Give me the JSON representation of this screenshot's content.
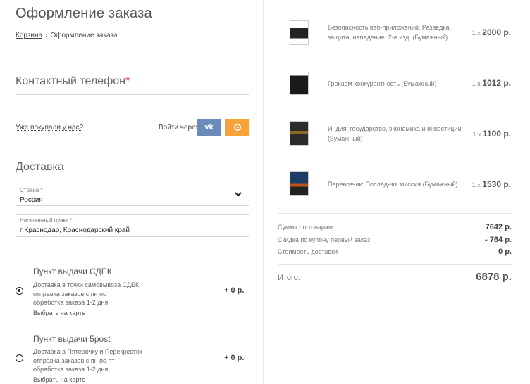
{
  "header": {
    "title": "Оформление заказа",
    "breadcrumb": {
      "cart": "Корзина",
      "separator": "›",
      "current": "Оформление заказа"
    }
  },
  "contact": {
    "title": "Контактный телефон",
    "required_mark": "*",
    "phone_value": "",
    "already_bought_link": "Уже покупали у нас?",
    "login_via": "Войти через",
    "vk_label": "vk"
  },
  "delivery": {
    "title": "Доставка",
    "country": {
      "label": "Страна",
      "required_mark": "*",
      "value": "Россия"
    },
    "city": {
      "label": "Населенный пункт",
      "required_mark": "*",
      "value": "г Краснодар, Краснодарский край"
    },
    "options": [
      {
        "title": "Пункт выдачи СДЕК",
        "desc_lines": [
          "Доставка в точки самовывоза СДЕК",
          "отправка заказов с пн по пт",
          "обработка заказа 1-2 дня"
        ],
        "map_link": "Выбрать на карте",
        "price": "+ 0 р.",
        "selected": true
      },
      {
        "title": "Пункт выдачи 5post",
        "desc_lines": [
          "Доставка в Пятерочку и Перекресток",
          "отправка заказов с пн по пт",
          "обработка заказа 1-2 дня"
        ],
        "map_link": "Выбрать на карте",
        "price": "+ 0 р.",
        "selected": false
      }
    ]
  },
  "order": {
    "items": [
      {
        "name": "Безопасность веб-приложений. Разведка, защита, нападение. 2-е изд. (Бумажный)",
        "qty": "1 x",
        "price": "2000 р."
      },
      {
        "name": "Грокаем конкурентность (Бумажный)",
        "qty": "1 x",
        "price": "1012 р."
      },
      {
        "name": "Индия: государство, экономика и инвестиции (Бумажный)",
        "qty": "1 x",
        "price": "1100 р."
      },
      {
        "name": "Перевозчик: Последняя миссия (Бумажный)",
        "qty": "1 x",
        "price": "1530 р."
      }
    ],
    "summary": {
      "goods_label": "Сумма по товарам",
      "goods_value": "7642 р.",
      "coupon_label": "Скидка по купону первый заказ",
      "coupon_value": "- 764 р.",
      "shipping_label": "Стоимость доставки",
      "shipping_value": "0 р."
    },
    "total_label": "Итого:",
    "total_value": "6878 р."
  },
  "colors": {
    "vk": "#6b8cba",
    "ok": "#f7a33a",
    "required": "#d9534f"
  }
}
